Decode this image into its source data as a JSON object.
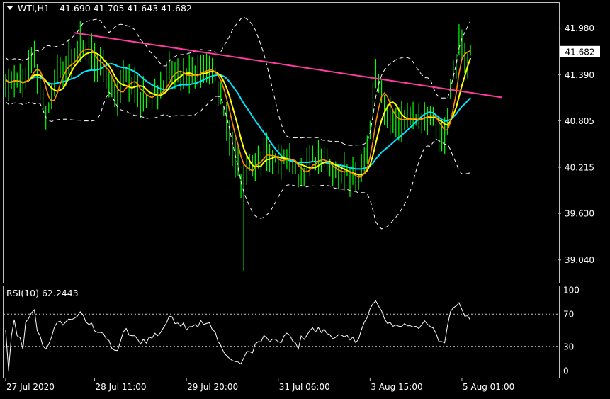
{
  "header": {
    "title": "WTI,H1",
    "ohlc": "41.690 41.705 41.643 41.682"
  },
  "rsi_header": "RSI(10) 62.2443",
  "price_label": "41.682",
  "colors": {
    "background": "#000000",
    "frame": "#c0c0c0",
    "text": "#ffffff",
    "candle": "#00ff00",
    "ma_fast": "#ff8c00",
    "ma_mid": "#ffff00",
    "ma_slow": "#00e5ff",
    "bands": "#ffffff",
    "trendline": "#ff3aa0",
    "rsi_line": "#ffffff",
    "price_tag_bg": "#ffffff",
    "price_tag_text": "#000000"
  },
  "chart_data": [
    {
      "type": "line",
      "panel": "price",
      "ylim": [
        38.75,
        42.3
      ],
      "y_ticks": [
        41.98,
        41.39,
        40.805,
        40.215,
        39.63,
        39.04
      ],
      "y_tick_labels": [
        "41.980",
        "41.390",
        "40.805",
        "40.215",
        "39.630",
        "39.040"
      ],
      "x_tick_labels": [
        "27 Jul 2020",
        "28 Jul 11:00",
        "29 Jul 20:00",
        "31 Jul 06:00",
        "3 Aug 15:00",
        "5 Aug 01:00"
      ],
      "x_tick_index": [
        0,
        31,
        63,
        95,
        127,
        159
      ],
      "n_bars": 163,
      "last_price": 41.682,
      "close_anchors": [
        [
          0,
          41.3
        ],
        [
          6,
          41.25
        ],
        [
          10,
          41.55
        ],
        [
          14,
          40.9
        ],
        [
          18,
          41.4
        ],
        [
          22,
          41.55
        ],
        [
          26,
          41.75
        ],
        [
          30,
          41.6
        ],
        [
          34,
          41.5
        ],
        [
          38,
          41.05
        ],
        [
          42,
          41.35
        ],
        [
          46,
          41.15
        ],
        [
          50,
          41.1
        ],
        [
          54,
          41.2
        ],
        [
          58,
          41.5
        ],
        [
          62,
          41.4
        ],
        [
          70,
          41.45
        ],
        [
          74,
          41.3
        ],
        [
          78,
          40.6
        ],
        [
          82,
          40.1
        ],
        [
          86,
          40.25
        ],
        [
          90,
          40.4
        ],
        [
          94,
          40.25
        ],
        [
          98,
          40.35
        ],
        [
          102,
          40.1
        ],
        [
          106,
          40.3
        ],
        [
          110,
          40.3
        ],
        [
          114,
          40.2
        ],
        [
          118,
          40.1
        ],
        [
          122,
          40.05
        ],
        [
          126,
          40.4
        ],
        [
          129,
          41.35
        ],
        [
          132,
          40.95
        ],
        [
          136,
          40.8
        ],
        [
          140,
          40.85
        ],
        [
          144,
          40.85
        ],
        [
          148,
          40.85
        ],
        [
          151,
          40.65
        ],
        [
          153,
          40.6
        ],
        [
          156,
          41.5
        ],
        [
          158,
          41.85
        ],
        [
          160,
          41.65
        ],
        [
          163,
          41.68
        ]
      ],
      "series": [
        {
          "name": "",
          "kind": "close"
        },
        {
          "name": "",
          "kind": "ma",
          "period": 5
        },
        {
          "name": "",
          "kind": "ma",
          "period": 8
        },
        {
          "name": "",
          "kind": "ma",
          "period": 21
        },
        {
          "name": "",
          "kind": "bollinger",
          "period": 20,
          "deviations": 2
        }
      ],
      "trendline": {
        "from": [
          24,
          41.92
        ],
        "to": [
          173,
          41.1
        ]
      },
      "spike_low": {
        "index": 83,
        "value": 38.9
      }
    },
    {
      "type": "line",
      "panel": "rsi",
      "ylim": [
        0,
        100
      ],
      "y_ticks": [
        100,
        70,
        30,
        0
      ],
      "y_tick_labels": [
        "100",
        "70",
        "30",
        "0"
      ],
      "levels": [
        70,
        30
      ],
      "current_value": 62.2443
    }
  ]
}
